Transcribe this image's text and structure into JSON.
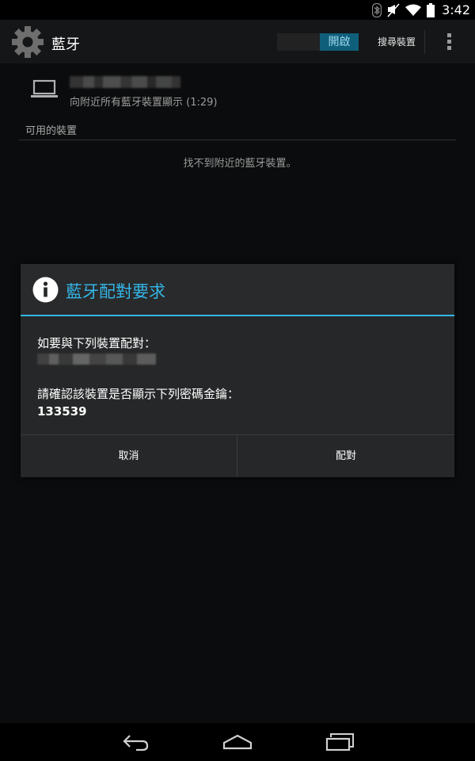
{
  "status_bar": {
    "time": "3:42",
    "icons": [
      "bluetooth-icon",
      "mute-icon",
      "wifi-icon",
      "battery-icon"
    ]
  },
  "action_bar": {
    "title": "藍牙",
    "toggle_state": "開啟",
    "search_label": "搜尋裝置",
    "overflow_icon": "overflow-menu-icon"
  },
  "this_device": {
    "icon": "laptop-icon",
    "visibility_text": "向附近所有藍牙裝置顯示 (1:29)"
  },
  "available_devices": {
    "header": "可用的裝置",
    "empty_message": "找不到附近的藍牙裝置。"
  },
  "dialog": {
    "icon": "info-icon",
    "title": "藍牙配對要求",
    "pair_prompt": "如要與下列裝置配對：",
    "confirm_prompt": "請確認該裝置是否顯示下列密碼金鑰：",
    "passkey": "133539",
    "cancel_label": "取消",
    "pair_label": "配對"
  },
  "colors": {
    "accent": "#33b5e5",
    "toggle_on": "#0f5e7a",
    "background": "#0b0c0d",
    "dialog": "#262728"
  },
  "nav_bar": {
    "icons": [
      "back-icon",
      "home-icon",
      "recents-icon"
    ]
  }
}
